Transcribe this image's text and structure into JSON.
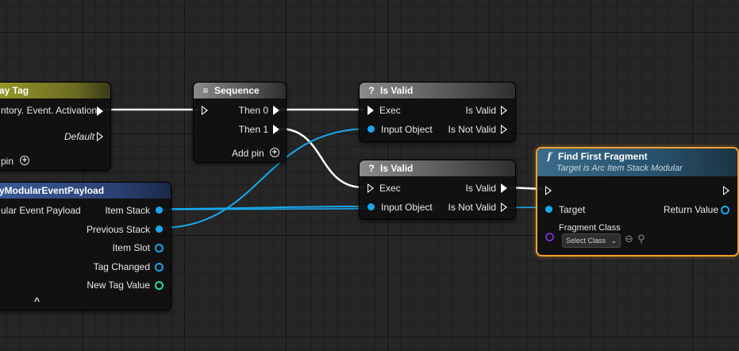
{
  "nodes": {
    "gameplay_tag": {
      "title": "ay Tag",
      "out_label": "ntory. Event. Activation",
      "default_label": "Default",
      "add_pin": "pin"
    },
    "payload": {
      "title": "yModularEventPayload",
      "in_label": "ular Event Payload",
      "pins": [
        "Item Stack",
        "Previous Stack",
        "Item Slot",
        "Tag Changed",
        "New Tag Value"
      ],
      "collapse": "^"
    },
    "sequence": {
      "title": "Sequence",
      "then0": "Then 0",
      "then1": "Then 1",
      "add_pin": "Add pin"
    },
    "is_valid_1": {
      "title": "Is Valid",
      "exec": "Exec",
      "input": "Input Object",
      "is_valid": "Is Valid",
      "is_not_valid": "Is Not Valid"
    },
    "is_valid_2": {
      "title": "Is Valid",
      "exec": "Exec",
      "input": "Input Object",
      "is_valid": "Is Valid",
      "is_not_valid": "Is Not Valid"
    },
    "find_first_fragment": {
      "title": "Find First Fragment",
      "subtitle": "Target is Arc Item Stack Modular",
      "target": "Target",
      "return_value": "Return Value",
      "fragment_class": "Fragment Class",
      "select_class": "Select Class"
    }
  },
  "icons": {
    "sequence": "sequence-icon",
    "is_valid": "question-mark-icon",
    "function": "function-f-icon",
    "add": "plus-circle-icon",
    "back": "arrow-left-circle-icon",
    "browse": "magnifier-icon"
  },
  "colors": {
    "exec_wire": "#ffffff",
    "object_wire": "#18a8ec",
    "class_pin": "#7a2ec8",
    "bool_pin": "#2ad8a0",
    "selected_border": "#f0a030"
  }
}
